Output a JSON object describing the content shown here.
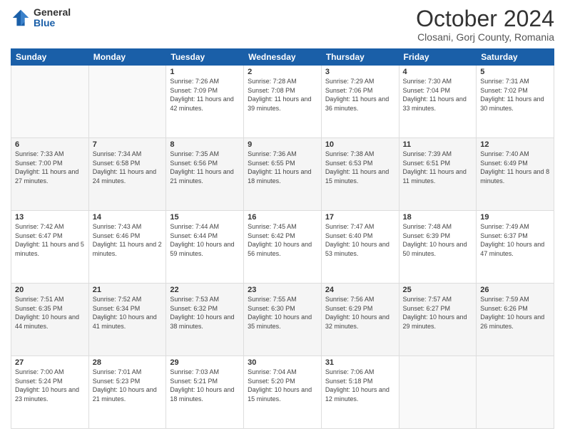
{
  "header": {
    "logo_general": "General",
    "logo_blue": "Blue",
    "month_title": "October 2024",
    "location": "Closani, Gorj County, Romania"
  },
  "days_of_week": [
    "Sunday",
    "Monday",
    "Tuesday",
    "Wednesday",
    "Thursday",
    "Friday",
    "Saturday"
  ],
  "weeks": [
    [
      {
        "day": "",
        "sunrise": "",
        "sunset": "",
        "daylight": ""
      },
      {
        "day": "",
        "sunrise": "",
        "sunset": "",
        "daylight": ""
      },
      {
        "day": "1",
        "sunrise": "Sunrise: 7:26 AM",
        "sunset": "Sunset: 7:09 PM",
        "daylight": "Daylight: 11 hours and 42 minutes."
      },
      {
        "day": "2",
        "sunrise": "Sunrise: 7:28 AM",
        "sunset": "Sunset: 7:08 PM",
        "daylight": "Daylight: 11 hours and 39 minutes."
      },
      {
        "day": "3",
        "sunrise": "Sunrise: 7:29 AM",
        "sunset": "Sunset: 7:06 PM",
        "daylight": "Daylight: 11 hours and 36 minutes."
      },
      {
        "day": "4",
        "sunrise": "Sunrise: 7:30 AM",
        "sunset": "Sunset: 7:04 PM",
        "daylight": "Daylight: 11 hours and 33 minutes."
      },
      {
        "day": "5",
        "sunrise": "Sunrise: 7:31 AM",
        "sunset": "Sunset: 7:02 PM",
        "daylight": "Daylight: 11 hours and 30 minutes."
      }
    ],
    [
      {
        "day": "6",
        "sunrise": "Sunrise: 7:33 AM",
        "sunset": "Sunset: 7:00 PM",
        "daylight": "Daylight: 11 hours and 27 minutes."
      },
      {
        "day": "7",
        "sunrise": "Sunrise: 7:34 AM",
        "sunset": "Sunset: 6:58 PM",
        "daylight": "Daylight: 11 hours and 24 minutes."
      },
      {
        "day": "8",
        "sunrise": "Sunrise: 7:35 AM",
        "sunset": "Sunset: 6:56 PM",
        "daylight": "Daylight: 11 hours and 21 minutes."
      },
      {
        "day": "9",
        "sunrise": "Sunrise: 7:36 AM",
        "sunset": "Sunset: 6:55 PM",
        "daylight": "Daylight: 11 hours and 18 minutes."
      },
      {
        "day": "10",
        "sunrise": "Sunrise: 7:38 AM",
        "sunset": "Sunset: 6:53 PM",
        "daylight": "Daylight: 11 hours and 15 minutes."
      },
      {
        "day": "11",
        "sunrise": "Sunrise: 7:39 AM",
        "sunset": "Sunset: 6:51 PM",
        "daylight": "Daylight: 11 hours and 11 minutes."
      },
      {
        "day": "12",
        "sunrise": "Sunrise: 7:40 AM",
        "sunset": "Sunset: 6:49 PM",
        "daylight": "Daylight: 11 hours and 8 minutes."
      }
    ],
    [
      {
        "day": "13",
        "sunrise": "Sunrise: 7:42 AM",
        "sunset": "Sunset: 6:47 PM",
        "daylight": "Daylight: 11 hours and 5 minutes."
      },
      {
        "day": "14",
        "sunrise": "Sunrise: 7:43 AM",
        "sunset": "Sunset: 6:46 PM",
        "daylight": "Daylight: 11 hours and 2 minutes."
      },
      {
        "day": "15",
        "sunrise": "Sunrise: 7:44 AM",
        "sunset": "Sunset: 6:44 PM",
        "daylight": "Daylight: 10 hours and 59 minutes."
      },
      {
        "day": "16",
        "sunrise": "Sunrise: 7:45 AM",
        "sunset": "Sunset: 6:42 PM",
        "daylight": "Daylight: 10 hours and 56 minutes."
      },
      {
        "day": "17",
        "sunrise": "Sunrise: 7:47 AM",
        "sunset": "Sunset: 6:40 PM",
        "daylight": "Daylight: 10 hours and 53 minutes."
      },
      {
        "day": "18",
        "sunrise": "Sunrise: 7:48 AM",
        "sunset": "Sunset: 6:39 PM",
        "daylight": "Daylight: 10 hours and 50 minutes."
      },
      {
        "day": "19",
        "sunrise": "Sunrise: 7:49 AM",
        "sunset": "Sunset: 6:37 PM",
        "daylight": "Daylight: 10 hours and 47 minutes."
      }
    ],
    [
      {
        "day": "20",
        "sunrise": "Sunrise: 7:51 AM",
        "sunset": "Sunset: 6:35 PM",
        "daylight": "Daylight: 10 hours and 44 minutes."
      },
      {
        "day": "21",
        "sunrise": "Sunrise: 7:52 AM",
        "sunset": "Sunset: 6:34 PM",
        "daylight": "Daylight: 10 hours and 41 minutes."
      },
      {
        "day": "22",
        "sunrise": "Sunrise: 7:53 AM",
        "sunset": "Sunset: 6:32 PM",
        "daylight": "Daylight: 10 hours and 38 minutes."
      },
      {
        "day": "23",
        "sunrise": "Sunrise: 7:55 AM",
        "sunset": "Sunset: 6:30 PM",
        "daylight": "Daylight: 10 hours and 35 minutes."
      },
      {
        "day": "24",
        "sunrise": "Sunrise: 7:56 AM",
        "sunset": "Sunset: 6:29 PM",
        "daylight": "Daylight: 10 hours and 32 minutes."
      },
      {
        "day": "25",
        "sunrise": "Sunrise: 7:57 AM",
        "sunset": "Sunset: 6:27 PM",
        "daylight": "Daylight: 10 hours and 29 minutes."
      },
      {
        "day": "26",
        "sunrise": "Sunrise: 7:59 AM",
        "sunset": "Sunset: 6:26 PM",
        "daylight": "Daylight: 10 hours and 26 minutes."
      }
    ],
    [
      {
        "day": "27",
        "sunrise": "Sunrise: 7:00 AM",
        "sunset": "Sunset: 5:24 PM",
        "daylight": "Daylight: 10 hours and 23 minutes."
      },
      {
        "day": "28",
        "sunrise": "Sunrise: 7:01 AM",
        "sunset": "Sunset: 5:23 PM",
        "daylight": "Daylight: 10 hours and 21 minutes."
      },
      {
        "day": "29",
        "sunrise": "Sunrise: 7:03 AM",
        "sunset": "Sunset: 5:21 PM",
        "daylight": "Daylight: 10 hours and 18 minutes."
      },
      {
        "day": "30",
        "sunrise": "Sunrise: 7:04 AM",
        "sunset": "Sunset: 5:20 PM",
        "daylight": "Daylight: 10 hours and 15 minutes."
      },
      {
        "day": "31",
        "sunrise": "Sunrise: 7:06 AM",
        "sunset": "Sunset: 5:18 PM",
        "daylight": "Daylight: 10 hours and 12 minutes."
      },
      {
        "day": "",
        "sunrise": "",
        "sunset": "",
        "daylight": ""
      },
      {
        "day": "",
        "sunrise": "",
        "sunset": "",
        "daylight": ""
      }
    ]
  ]
}
